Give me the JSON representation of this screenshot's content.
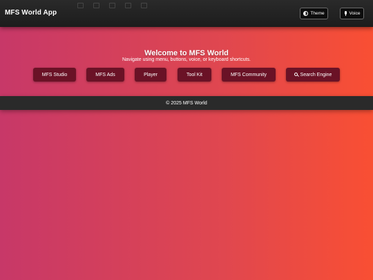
{
  "app": {
    "title": "MFS World App"
  },
  "header": {
    "theme_label": "Theme",
    "voice_label": "Voice",
    "theme_icon": "half-circle-icon",
    "voice_icon": "microphone-icon"
  },
  "main": {
    "welcome": "Welcome to MFS World",
    "subtitle": "Navigate using menu, buttons, voice, or keyboard shortcuts.",
    "buttons": [
      {
        "label": "MFS Studio"
      },
      {
        "label": "MFS Ads"
      },
      {
        "label": "Player"
      },
      {
        "label": "Tool Kit"
      },
      {
        "label": "MFS Community"
      },
      {
        "label": "Search Engine",
        "icon": "search-icon"
      }
    ]
  },
  "footer": {
    "text": "© 2025 MFS World"
  },
  "colors": {
    "gradient_start": "#c73868",
    "gradient_end": "#f94f33",
    "button_bg": "#6a1226",
    "header_bg": "#1c1c1c",
    "footer_bg": "#2a2a2a"
  }
}
